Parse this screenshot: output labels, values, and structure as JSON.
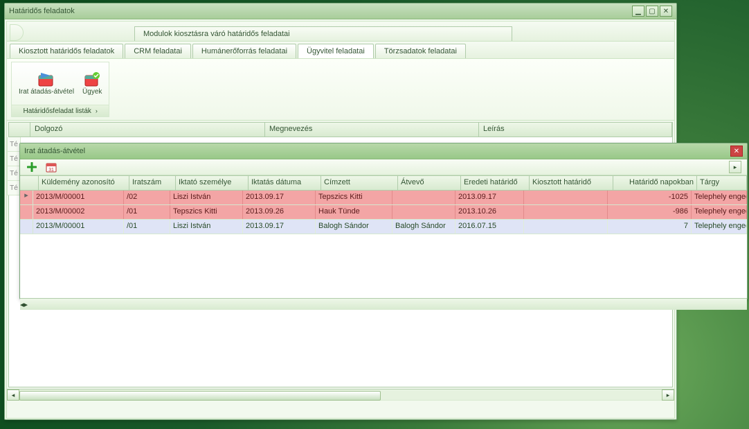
{
  "main": {
    "title": "Határidős feladatok",
    "groupLabel": "Modulok kiosztásra váró határidős feladatai",
    "tabs": {
      "t0": "Kiosztott határidős feladatok",
      "t1": "CRM feladatai",
      "t2": "Humánerőforrás feladatai",
      "t3": "Ügyvitel feladatai",
      "t4": "Törzsadatok feladatai"
    },
    "ribbon": {
      "btn1": "Irat átadás-átvétel",
      "btn2": "Ügyek",
      "groupLabel": "Határidősfeladat listák"
    },
    "gridCols": {
      "c1": "Dolgozó",
      "c2": "Megnevezés",
      "c3": "Leírás"
    },
    "peek": [
      "Té",
      "Té",
      "Té",
      "Té"
    ]
  },
  "sub": {
    "title": "Irat átadás-átvétel",
    "cols": {
      "id": "Küldemény azonosító",
      "ir": "Iratszám",
      "ik": "Iktató személye",
      "dt": "Iktatás dátuma",
      "cm": "Címzett",
      "at": "Átvevő",
      "eh": "Eredeti határidő",
      "kh": "Kiosztott határidő",
      "hn": "Határidő napokban",
      "tg": "Tárgy"
    },
    "rows": [
      {
        "sel": "▸",
        "cls": "row-red",
        "id": "2013/M/00001",
        "ir": "/02",
        "ik": "Liszi István",
        "dt": "2013.09.17",
        "cm": "Tepszics Kitti",
        "at": "",
        "eh": "2013.09.17",
        "kh": "",
        "hn": "-1025",
        "tg": "Telephely engedélyeztetés melléklet"
      },
      {
        "sel": "",
        "cls": "row-red",
        "id": "2013/M/00002",
        "ir": "/01",
        "ik": "Tepszics Kitti",
        "dt": "2013.09.26",
        "cm": "Hauk Tünde",
        "at": "",
        "eh": "2013.10.26",
        "kh": "",
        "hn": "-986",
        "tg": "Telephely engedélyeztetés"
      },
      {
        "sel": "",
        "cls": "row-blue",
        "id": "2013/M/00001",
        "ir": "/01",
        "ik": "Liszi István",
        "dt": "2013.09.17",
        "cm": "Balogh Sándor",
        "at": "Balogh Sándor",
        "eh": "2016.07.15",
        "kh": "",
        "hn": "7",
        "tg": "Telephely engedélyeztetés"
      }
    ]
  }
}
